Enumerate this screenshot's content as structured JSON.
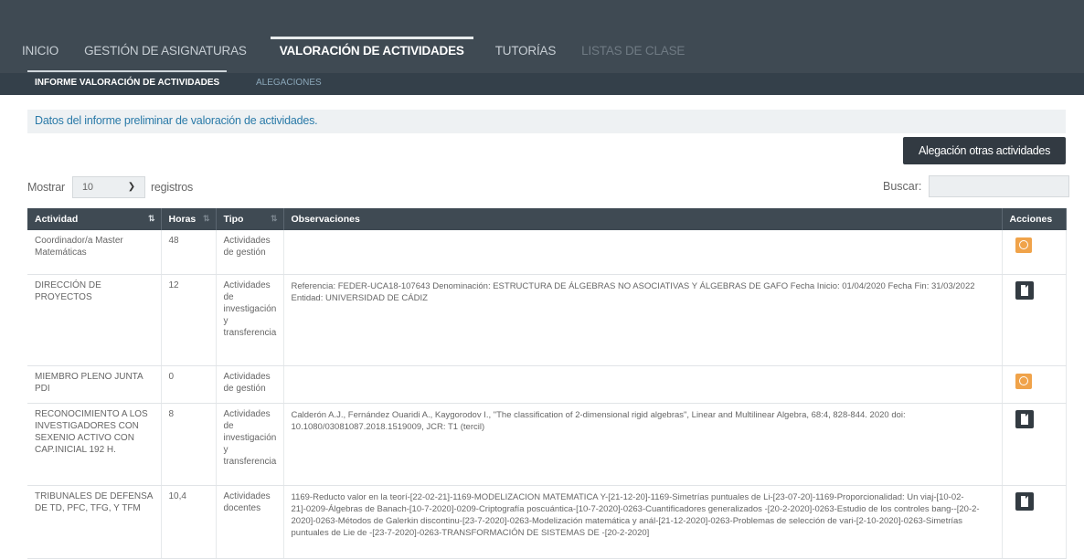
{
  "nav": {
    "items": [
      {
        "label": "INICIO",
        "state": "normal"
      },
      {
        "label": "GESTIÓN DE ASIGNATURAS",
        "state": "normal"
      },
      {
        "label": "VALORACIÓN DE ACTIVIDADES",
        "state": "active"
      },
      {
        "label": "TUTORÍAS",
        "state": "normal"
      },
      {
        "label": "LISTAS DE CLASE",
        "state": "disabled"
      }
    ]
  },
  "subnav": {
    "active": "INFORME VALORACIÓN DE ACTIVIDADES",
    "inactive": "ALEGACIONES"
  },
  "info_text": "Datos del informe preliminar de valoración de actividades.",
  "alegacion_button": "Alegación otras actividades",
  "length": {
    "prefix": "Mostrar",
    "value": "10",
    "suffix": "registros"
  },
  "search": {
    "label": "Buscar:",
    "value": ""
  },
  "table": {
    "headers": [
      "Actividad",
      "Horas",
      "Tipo",
      "Observaciones",
      "Acciones"
    ],
    "rows": [
      {
        "actividad": "Coordinador/a Master Matemáticas",
        "horas": "48",
        "tipo": "Actividades de gestión",
        "observaciones": "",
        "accion": "warning-icon"
      },
      {
        "actividad": "DIRECCIÓN DE PROYECTOS",
        "horas": "12",
        "tipo": "Actividades de investigación y transferencia",
        "observaciones": "Referencia: FEDER-UCA18-107643 Denominación: ESTRUCTURA DE ÁLGEBRAS NO ASOCIATIVAS Y ÁLGEBRAS DE GAFO Fecha Inicio: 01/04/2020 Fecha Fin: 31/03/2022 Entidad: UNIVERSIDAD DE CÁDIZ",
        "accion": "document-icon"
      },
      {
        "actividad": "MIEMBRO PLENO JUNTA PDI",
        "horas": "0",
        "tipo": "Actividades de gestión",
        "observaciones": "",
        "accion": "warning-icon"
      },
      {
        "actividad": "RECONOCIMIENTO A LOS INVESTIGADORES CON SEXENIO ACTIVO CON CAP.INICIAL 192 H.",
        "horas": "8",
        "tipo": "Actividades de investigación y transferencia",
        "observaciones": "Calderón A.J., Fernández Ouaridi A., Kaygorodov I., \"The classification of 2-dimensional rigid algebras\", Linear and Multilinear Algebra, 68:4, 828-844. 2020 doi: 10.1080/03081087.2018.1519009, JCR: T1 (tercil)",
        "accion": "document-icon"
      },
      {
        "actividad": "TRIBUNALES DE DEFENSA DE TD, PFC, TFG, Y TFM",
        "horas": "10,4",
        "tipo": "Actividades docentes",
        "observaciones": "1169-Reducto valor en la teorí-[22-02-21]-1169-MODELIZACION MATEMATICA Y-[21-12-20]-1169-Simetrías puntuales de Li-[23-07-20]-1169-Proporcionalidad: Un viaj-[10-02-21]-0209-Álgebras de Banach-[10-7-2020]-0209-Criptografía poscuántica-[10-7-2020]-0263-Cuantificadores generalizados -[20-2-2020]-0263-Estudio de los controles bang--[20-2-2020]-0263-Métodos de Galerkin discontinu-[23-7-2020]-0263-Modelización matemática y anál-[21-12-2020]-0263-Problemas de selección de vari-[2-10-2020]-0263-Simetrías puntuales de Lie de -[23-7-2020]-0263-TRANSFORMACIÓN DE SISTEMAS DE -[20-2-2020]",
        "accion": "document-icon"
      }
    ]
  },
  "colors": {
    "header_bg": "#3f4a53",
    "info_text": "#2a7aa8",
    "warning": "#f0a34a"
  }
}
